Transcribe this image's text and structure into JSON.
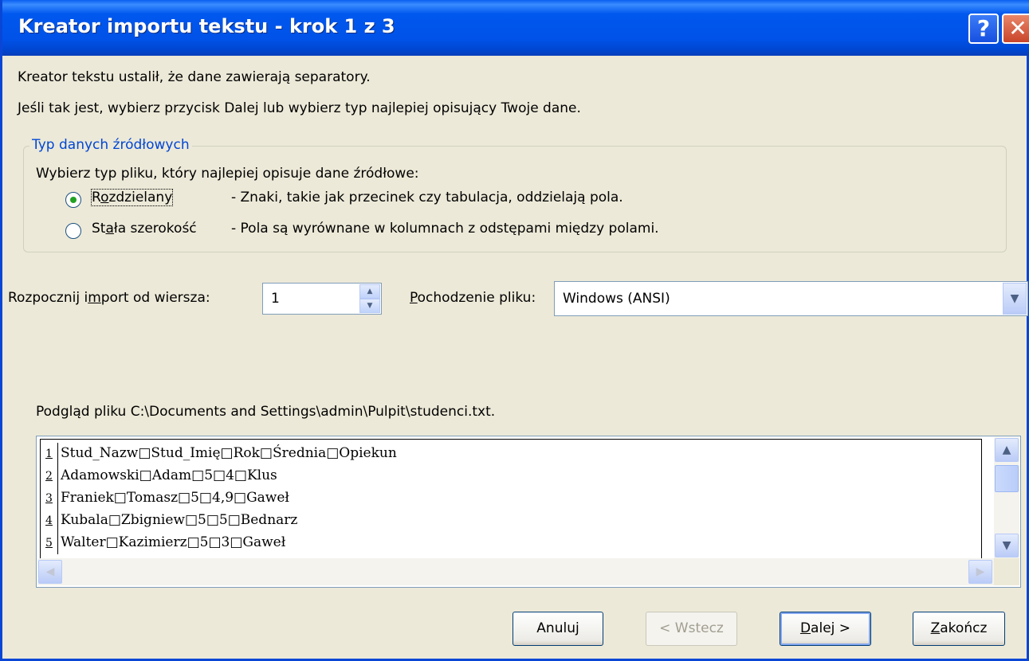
{
  "window": {
    "title": "Kreator importu tekstu - krok 1 z 3",
    "help_glyph": "?",
    "close_glyph": "✕"
  },
  "intro": {
    "line1": "Kreator tekstu ustalił, że dane zawierają separatory.",
    "line2": "Jeśli tak jest, wybierz przycisk Dalej lub wybierz typ najlepiej opisujący Twoje dane."
  },
  "source_type": {
    "legend": "Typ danych źródłowych",
    "prompt": "Wybierz typ pliku, który najlepiej opisuje dane źródłowe:",
    "options": [
      {
        "label_pre": "R",
        "label_acc": "o",
        "label_post": "zdzielany",
        "description": "- Znaki, takie jak przecinek czy tabulacja, oddzielają pola.",
        "selected": true
      },
      {
        "label_pre": "St",
        "label_acc": "a",
        "label_post": "ła szerokość",
        "description": "- Pola są wyrównane w kolumnach z odstępami między polami.",
        "selected": false
      }
    ]
  },
  "import_row": {
    "label_pre": "Rozpocznij i",
    "label_acc": "m",
    "label_post": "port od wiersza:",
    "value": "1"
  },
  "origin": {
    "label_acc": "P",
    "label_post": "ochodzenie pliku:",
    "value": "Windows (ANSI)"
  },
  "preview": {
    "label": "Podgląd pliku C:\\Documents and Settings\\admin\\Pulpit\\studenci.txt.",
    "rows": [
      {
        "num": "1",
        "text": "Stud_Nazw□Stud_Imię□Rok□Średnia□Opiekun"
      },
      {
        "num": "2",
        "text": "Adamowski□Adam□5□4□Klus"
      },
      {
        "num": "3",
        "text": "Franiek□Tomasz□5□4,9□Gaweł"
      },
      {
        "num": "4",
        "text": "Kubala□Zbigniew□5□5□Bednarz"
      },
      {
        "num": "5",
        "text": "Walter□Kazimierz□5□3□Gaweł"
      }
    ]
  },
  "buttons": {
    "cancel": "Anuluj",
    "back": "< Wstecz",
    "next_acc": "D",
    "next_post": "alej >",
    "finish_acc": "Z",
    "finish_post": "akończ"
  },
  "icons": [
    "help-icon",
    "close-icon",
    "spin-up-icon",
    "spin-down-icon",
    "dropdown-arrow-icon",
    "scroll-up-icon",
    "scroll-down-icon",
    "scroll-left-icon",
    "scroll-right-icon"
  ]
}
